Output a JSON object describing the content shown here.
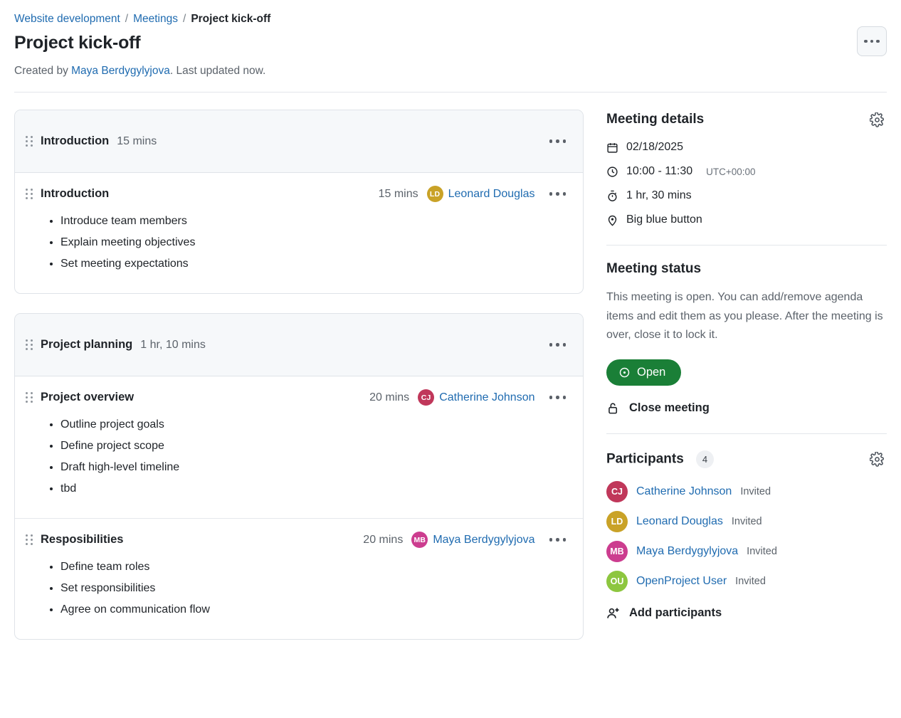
{
  "breadcrumb": [
    {
      "label": "Website development",
      "current": false
    },
    {
      "label": "Meetings",
      "current": false
    },
    {
      "label": "Project kick-off",
      "current": true
    }
  ],
  "header": {
    "title": "Project kick-off",
    "created_prefix": "Created by ",
    "created_by": "Maya Berdygylyjova",
    "created_suffix": ". Last updated now."
  },
  "agenda": {
    "sections": [
      {
        "title": "Introduction",
        "duration": "15 mins",
        "items": [
          {
            "title": "Introduction",
            "duration": "15 mins",
            "owner": "Leonard Douglas",
            "initials": "LD",
            "color": "#c9a227",
            "notes": [
              "Introduce team members",
              "Explain meeting objectives",
              "Set meeting expectations"
            ]
          }
        ]
      },
      {
        "title": "Project planning",
        "duration": "1 hr, 10 mins",
        "items": [
          {
            "title": "Project overview",
            "duration": "20 mins",
            "owner": "Catherine Johnson",
            "initials": "CJ",
            "color": "#c0375a",
            "notes": [
              "Outline project goals",
              "Define project scope",
              "Draft high-level timeline",
              "tbd"
            ]
          },
          {
            "title": "Resposibilities",
            "duration": "20 mins",
            "owner": "Maya Berdygylyjova",
            "initials": "MB",
            "color": "#cc3d8f",
            "notes": [
              "Define team roles",
              "Set responsibilities",
              "Agree on communication flow"
            ]
          }
        ]
      }
    ]
  },
  "sidebar": {
    "details": {
      "heading": "Meeting details",
      "date": "02/18/2025",
      "time": "10:00 - 11:30",
      "timezone": "UTC+00:00",
      "duration": "1 hr, 30 mins",
      "location": "Big blue button"
    },
    "status": {
      "heading": "Meeting status",
      "description": "This meeting is open. You can add/remove agenda items and edit them as you please. After the meeting is over, close it to lock it.",
      "badge_label": "Open",
      "badge_color": "#1a7f37",
      "close_label": "Close meeting"
    },
    "participants": {
      "heading": "Participants",
      "count": "4",
      "add_label": "Add participants",
      "list": [
        {
          "name": "Catherine Johnson",
          "initials": "CJ",
          "status": "Invited",
          "color": "#c0375a"
        },
        {
          "name": "Leonard Douglas",
          "initials": "LD",
          "status": "Invited",
          "color": "#c9a227"
        },
        {
          "name": "Maya Berdygylyjova",
          "initials": "MB",
          "status": "Invited",
          "color": "#cc3d8f"
        },
        {
          "name": "OpenProject User",
          "initials": "OU",
          "status": "Invited",
          "color": "#8dc63f"
        }
      ]
    }
  }
}
